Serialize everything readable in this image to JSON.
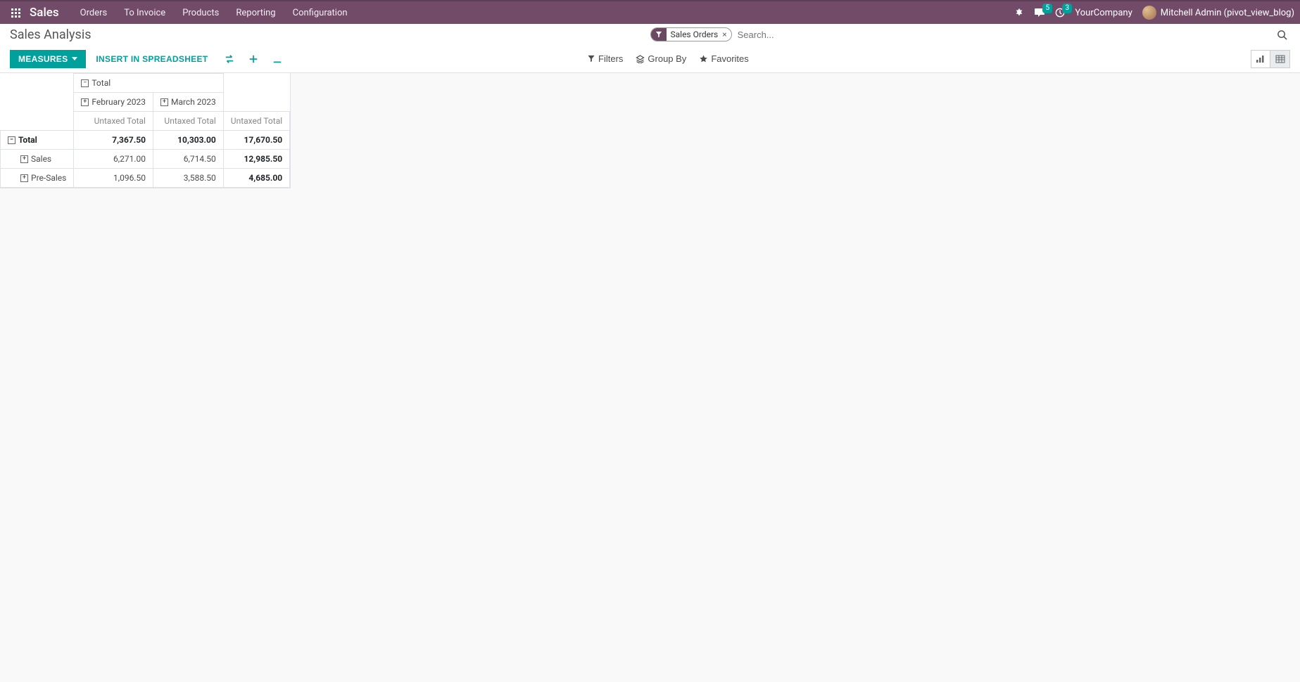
{
  "topbar": {
    "app_name": "Sales",
    "menu": [
      "Orders",
      "To Invoice",
      "Products",
      "Reporting",
      "Configuration"
    ],
    "messages_badge": "5",
    "activities_badge": "3",
    "company": "YourCompany",
    "user": "Mitchell Admin (pivot_view_blog)"
  },
  "header": {
    "title": "Sales Analysis",
    "search_filter_tag": "Sales Orders",
    "search_placeholder": "Search..."
  },
  "toolbar": {
    "measures_label": "MEASURES",
    "insert_label": "INSERT IN SPREADSHEET",
    "filters_label": "Filters",
    "groupby_label": "Group By",
    "favorites_label": "Favorites"
  },
  "pivot": {
    "col_total_label": "Total",
    "col_headers": [
      "February 2023",
      "March 2023"
    ],
    "measure_label": "Untaxed Total",
    "rows": [
      {
        "label": "Total",
        "expanded": true,
        "values": [
          "7,367.50",
          "10,303.00",
          "17,670.50"
        ],
        "is_total": true,
        "indent": 0
      },
      {
        "label": "Sales",
        "expanded": false,
        "values": [
          "6,271.00",
          "6,714.50",
          "12,985.50"
        ],
        "is_total": false,
        "indent": 1
      },
      {
        "label": "Pre-Sales",
        "expanded": false,
        "values": [
          "1,096.50",
          "3,588.50",
          "4,685.00"
        ],
        "is_total": false,
        "indent": 1
      }
    ]
  }
}
